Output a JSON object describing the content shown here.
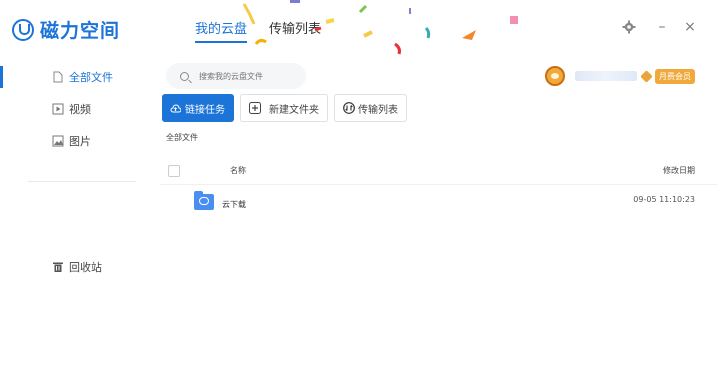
{
  "app": {
    "title": "磁力空间"
  },
  "top_tabs": [
    {
      "label": "我的云盘",
      "active": true
    },
    {
      "label": "传输列表",
      "active": false
    }
  ],
  "window_controls": {
    "settings": "gear-icon",
    "minimize": "–",
    "close": "×"
  },
  "sidebar": {
    "items": [
      {
        "label": "全部文件",
        "icon": "file-icon",
        "active": true
      },
      {
        "label": "视频",
        "icon": "video-icon",
        "active": false
      },
      {
        "label": "图片",
        "icon": "image-icon",
        "active": false
      }
    ],
    "recycle": {
      "label": "回收站",
      "icon": "trash-icon"
    }
  },
  "search": {
    "placeholder": "搜索我的云盘文件"
  },
  "user": {
    "vip_label": "月费会员"
  },
  "toolbar": {
    "link_task": "链接任务",
    "new_folder": "新建文件夹",
    "transfer_list": "传输列表"
  },
  "breadcrumb": "全部文件",
  "table": {
    "columns": {
      "name": "名称",
      "date": "修改日期"
    },
    "rows": [
      {
        "name": "云下载",
        "date": "09-05 11:10:23",
        "type": "folder"
      }
    ]
  },
  "colors": {
    "accent": "#1c74d8",
    "vip": "#f0a93a"
  }
}
